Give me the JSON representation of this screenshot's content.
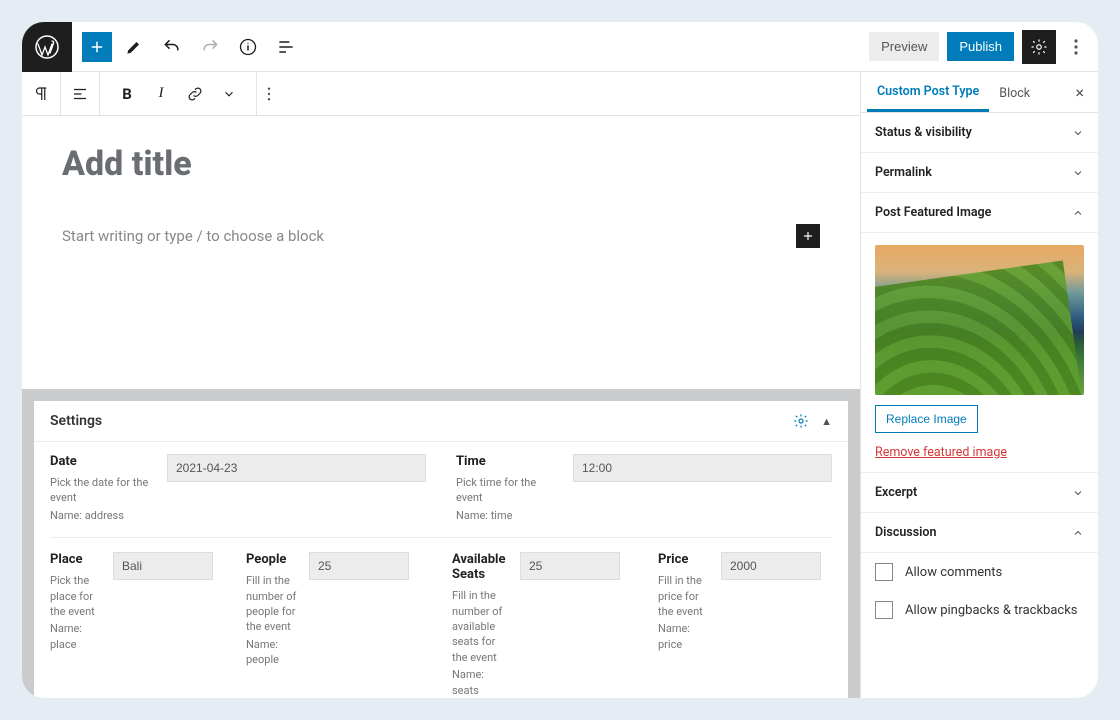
{
  "topbar": {
    "preview": "Preview",
    "publish": "Publish"
  },
  "editor": {
    "title_placeholder": "Add title",
    "writing_prompt": "Start writing or type / to choose a block"
  },
  "metabox": {
    "heading": "Settings",
    "fields": {
      "date": {
        "label": "Date",
        "value": "2021-04-23",
        "help1": "Pick the date for the event",
        "help2": "Name: address"
      },
      "time": {
        "label": "Time",
        "value": "12:00",
        "help1": "Pick time for the event",
        "help2": "Name: time"
      },
      "place": {
        "label": "Place",
        "value": "Bali",
        "help1": "Pick the place for the event",
        "help2": "Name: place"
      },
      "people": {
        "label": "People",
        "value": "25",
        "help1": "Fill in the number of people for the event",
        "help2": "Name: people"
      },
      "seats": {
        "label": "Available Seats",
        "value": "25",
        "help1": "Fill in the number of available seats for the event",
        "help2": "Name: seats"
      },
      "price": {
        "label": "Price",
        "value": "2000",
        "help1": "Fill in the price for the event",
        "help2": "Name: price"
      }
    }
  },
  "sidebar": {
    "tabs": {
      "cpt": "Custom Post Type",
      "block": "Block"
    },
    "status": "Status & visibility",
    "permalink": "Permalink",
    "featured": "Post Featured Image",
    "replace": "Replace Image",
    "remove": "Remove featured image",
    "excerpt": "Excerpt",
    "discussion": "Discussion",
    "allow_comments": "Allow comments",
    "allow_pingbacks": "Allow pingbacks & trackbacks"
  }
}
